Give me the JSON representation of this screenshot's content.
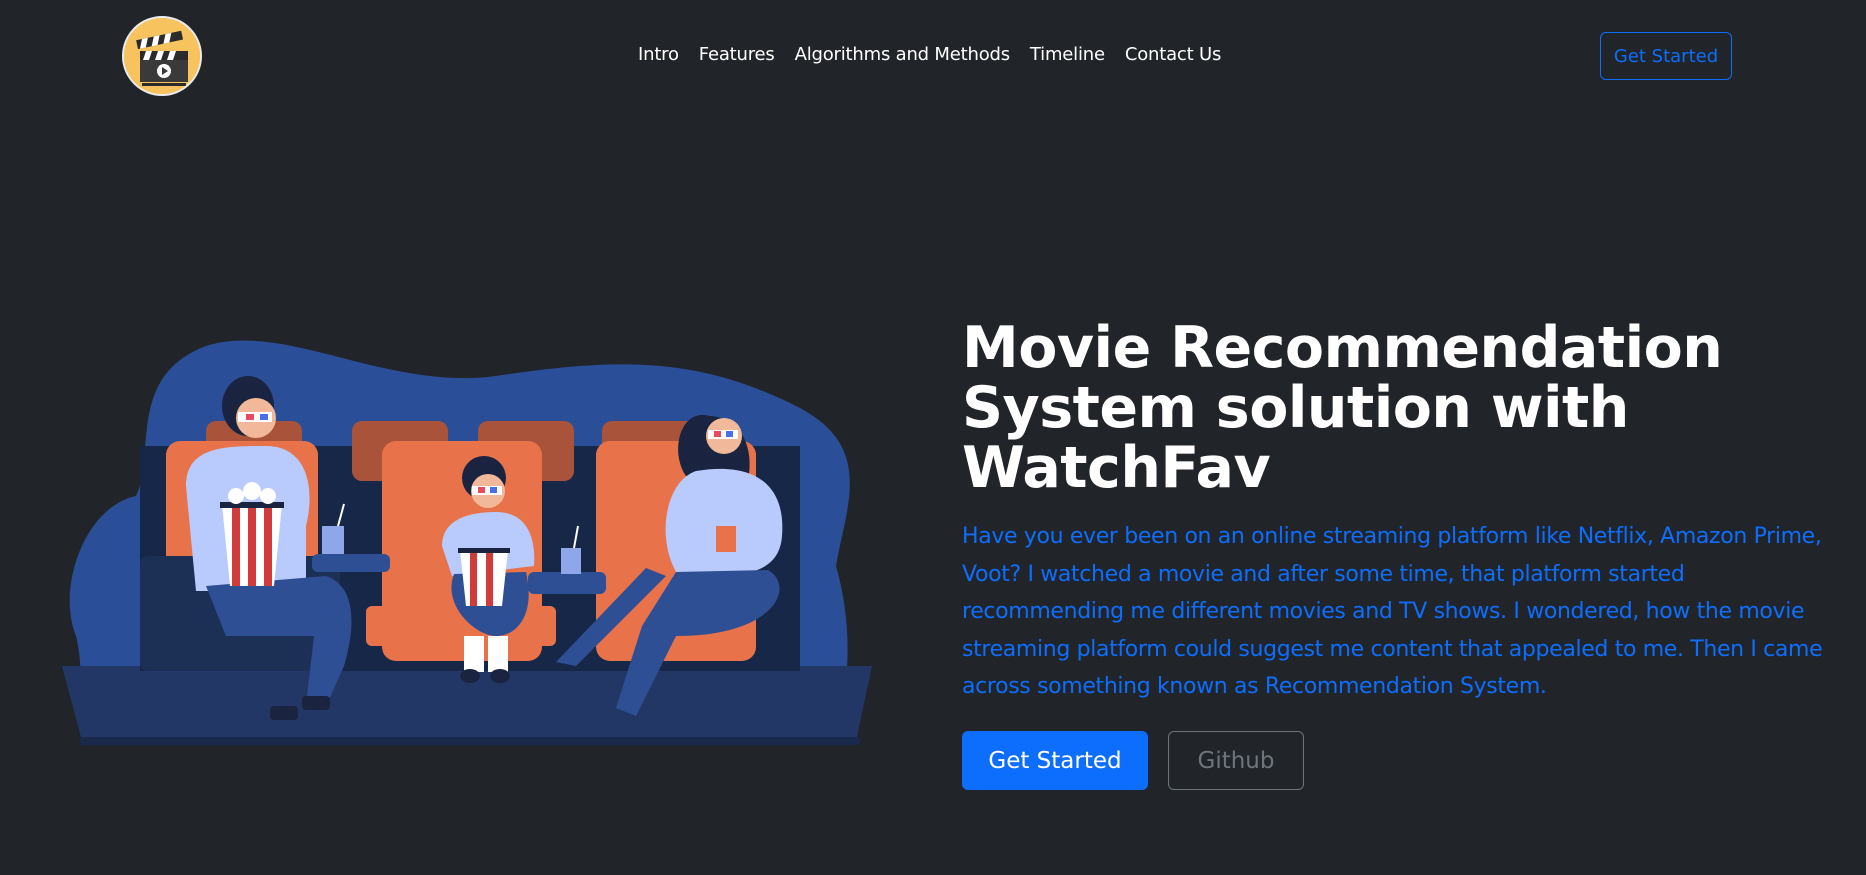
{
  "brand": {
    "logo_icon": "movie-clapperboard-icon"
  },
  "nav": {
    "links": [
      {
        "label": "Intro"
      },
      {
        "label": "Features"
      },
      {
        "label": "Algorithms and Methods"
      },
      {
        "label": "Timeline"
      },
      {
        "label": "Contact Us"
      }
    ],
    "cta_label": "Get Started"
  },
  "hero": {
    "illustration": "family-watching-movie-in-cinema-illustration",
    "title": "Movie Recommendation System solution with WatchFav",
    "lead": "Have you ever been on an online streaming platform like Netflix, Amazon Prime, Voot? I watched a movie and after some time, that platform started recommending me different movies and TV shows. I wondered, how the movie streaming platform could suggest me content that appealed to me. Then I came across something known as Recommendation System.",
    "primary_button": "Get Started",
    "secondary_button": "Github"
  },
  "colors": {
    "background": "#212529",
    "accent": "#0d6efd",
    "muted": "#6c757d",
    "logo_bg": "#f7c35f",
    "illustration_blob": "#2a4f98",
    "illustration_seat": "#e8734a"
  }
}
